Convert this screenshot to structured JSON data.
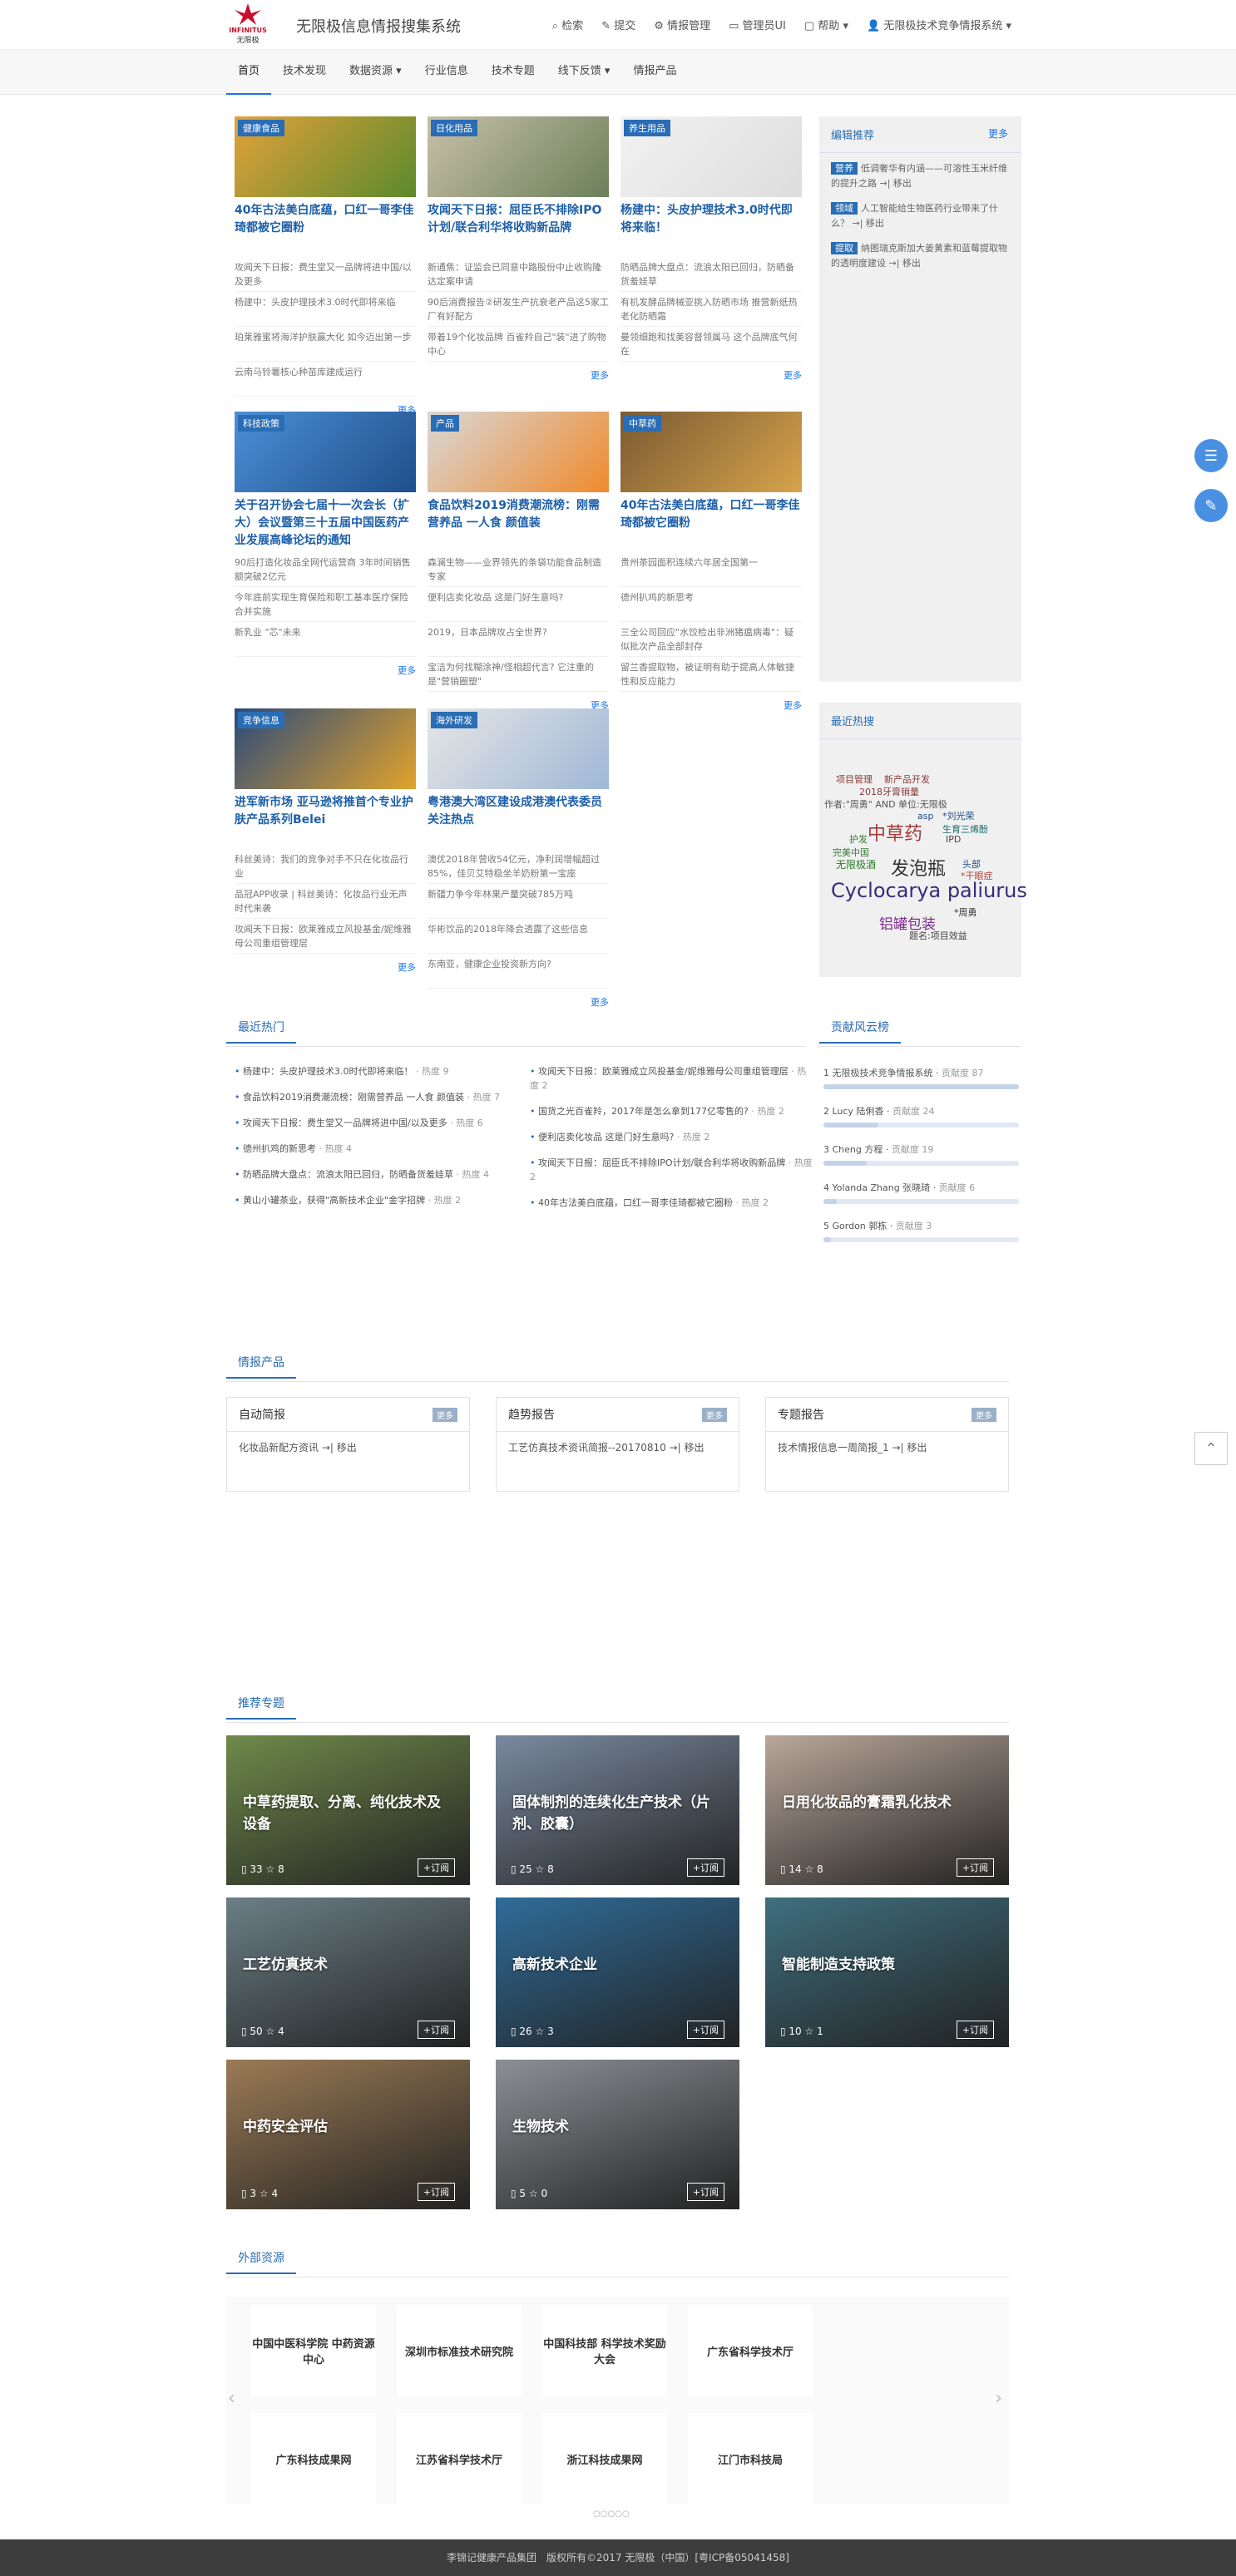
{
  "header": {
    "logo_en": "INFINITUS",
    "logo_cn": "无限极",
    "title": "无限极信息情报搜集系统",
    "nav": [
      "检索",
      "提交",
      "情报管理",
      "管理员UI",
      "帮助",
      "无限极技术竞争情报系统"
    ]
  },
  "menu": [
    "首页",
    "技术发现",
    "数据资源",
    "行业信息",
    "技术专题",
    "线下反馈",
    "情报产品"
  ],
  "cards": [
    {
      "tag": "健康食品",
      "title": "40年古法美白底蕴，口红一哥李佳琦都被它圈粉",
      "items": [
        "攻闻天下日报：费生堂又一品牌将进中国/以及更多",
        "杨建中：头皮护理技术3.0时代即将来临",
        "珀莱雅蜜将海洋护肤赢大化 如今迈出第一步",
        "云南马铃薯核心种苗库建成运行"
      ],
      "more": "更多"
    },
    {
      "tag": "日化用品",
      "title": "攻闻天下日报：屈臣氏不排除IPO计划/联合利华将收购新品牌",
      "items": [
        "新通焦：证监会已同意中路股份中止收购隆达定案申请",
        "90后消费报告②研发生产抗衰老产品这5家工厂有好配方",
        "带着19个化妆品牌 百雀羚自己\"装\"进了购物中心"
      ],
      "more": "更多"
    },
    {
      "tag": "养生用品",
      "title": "杨建中：头皮护理技术3.0时代即将来临！",
      "items": [
        "防晒品牌大盘点：流浪太阳已回归，防晒备货羞娃草",
        "有机发酵品牌械亚挑入防晒市场 推营新纸热老化防晒霜",
        "曼领细跑和找美容督领属马 这个品牌底气何在"
      ],
      "more": "更多"
    },
    {
      "tag": "科技政策",
      "title": "关于召开协会七届十一次会长（扩大）会议暨第三十五届中国医药产业发展高峰论坛的通知",
      "items": [
        "90后打造化妆品全网代运营商 3年时间销售额突破2亿元",
        "今年底前实现生育保险和职工基本医疗保险合并实施",
        "新乳业 \"芯\"未来"
      ],
      "more": "更多"
    },
    {
      "tag": "产品",
      "title": "食品饮料2019消费潮流榜：刚需营养品 一人食 颜值装",
      "items": [
        "森澜生物——业界领先的条袋功能食品制造专家",
        "便利店卖化妆品 这是门好生意吗?",
        "2019，日本品牌攻占全世界?",
        "宝洁为何找糊涂神/怪相超代言? 它注重的是\"营销圈塑\""
      ],
      "more": "更多"
    },
    {
      "tag": "中草药",
      "title": "40年古法美白底蕴，口红一哥李佳琦都被它圈粉",
      "items": [
        "贵州茶园面积连续六年居全国第一",
        "德州扒鸡的新思考",
        "三全公司回应\"水饺检出非洲猪瘟病毒\"：疑似批次产品全部封存",
        "留兰香提取物，被证明有助于提高人体敏捷性和反应能力"
      ],
      "more": "更多"
    },
    {
      "tag": "竞争信息",
      "title": "进军新市场 亚马逊将推首个专业护肤产品系列Belei",
      "items": [
        "科丝美诗：我们的竞争对手不只在化妆品行业",
        "品冠APP收录 | 科丝美诗：化妆品行业无声时代来袭",
        "攻闻天下日报：欧莱雅成立风投基金/妮维雅母公司重组管理层"
      ],
      "more": "更多"
    },
    {
      "tag": "海外研发",
      "title": "粤港澳大湾区建设成港澳代表委员关注热点",
      "items": [
        "澳优2018年营收54亿元，净利润增幅超过85%，佳贝艾特稳坐羊奶粉第一宝座",
        "新疆力争今年林果产量突破785万吨",
        "华彬饮品的2018年降会透露了这些信息",
        "东南亚，健康企业投资新方向?"
      ],
      "more": "更多"
    }
  ],
  "editor": {
    "title": "编辑推荐",
    "more": "更多",
    "items": [
      {
        "tag": "营养",
        "text": "低调奢华有内涵——可溶性玉米纤维的提升之路",
        "action": "→| 移出"
      },
      {
        "tag": "领域",
        "text": "人工智能给生物医药行业带来了什么？",
        "action": "→| 移出"
      },
      {
        "tag": "提取",
        "text": "纳图瑞克斯加大姜黄素和蓝莓提取物的透明度建设",
        "action": "→| 移出"
      }
    ]
  },
  "cloud": {
    "title": "最近热搜",
    "words": [
      "项目管理",
      "新产品开发",
      "2018牙膏销量",
      "作者:\"周勇\" AND 单位:无限极",
      "asp",
      "*刘光荣",
      "中草药",
      "生育三烯酚",
      "护发",
      "IPD",
      "完美中国",
      "无限极酒",
      "发泡瓶",
      "头部",
      "*干眼症",
      "Cyclocarya paliurus",
      "铝罐包装",
      "*周勇",
      "题名:项目效益"
    ]
  },
  "hot": {
    "title": "最近热门",
    "left": [
      {
        "t": "杨建中：头皮护理技术3.0时代即将来临！",
        "h": "热度 9"
      },
      {
        "t": "食品饮料2019消费潮流榜：刚需营养品 一人食 颜值装",
        "h": "热度 7"
      },
      {
        "t": "攻闻天下日报：费生堂又一品牌将进中国/以及更多",
        "h": "热度 6"
      },
      {
        "t": "德州扒鸡的新思考",
        "h": "热度 4"
      },
      {
        "t": "防晒品牌大盘点：流浪太阳已回归，防晒备货羞娃草",
        "h": "热度 4"
      },
      {
        "t": "黄山小罐茶业，获得\"高新技术企业\"金字招牌",
        "h": "热度 2"
      }
    ],
    "right": [
      {
        "t": "攻闻天下日报：欧莱雅成立风投基金/妮维雅母公司重组管理层",
        "h": "热度 2"
      },
      {
        "t": "国货之光百雀羚，2017年是怎么拿到177亿零售的?",
        "h": "热度 2"
      },
      {
        "t": "便利店卖化妆品 这是门好生意吗?",
        "h": "热度 2"
      },
      {
        "t": "攻闻天下日报：屈臣氏不排除IPO计划/联合利华将收购新品牌",
        "h": "热度 2"
      },
      {
        "t": "40年古法美白底蕴，口红一哥李佳琦都被它圈粉",
        "h": "热度 2"
      }
    ]
  },
  "rank": {
    "title": "贡献风云榜",
    "items": [
      {
        "n": "1",
        "name": "无限极技术竞争情报系统",
        "v": "贡献度 87",
        "pct": 1.0
      },
      {
        "n": "2",
        "name": "Lucy 陆俐香",
        "v": "贡献度 24",
        "pct": 0.28
      },
      {
        "n": "3",
        "name": "Cheng 方程",
        "v": "贡献度 19",
        "pct": 0.22
      },
      {
        "n": "4",
        "name": "Yolanda Zhang 张晓琦",
        "v": "贡献度 6",
        "pct": 0.07
      },
      {
        "n": "5",
        "name": "Gordon 郭栋",
        "v": "贡献度 3",
        "pct": 0.04
      }
    ]
  },
  "products": {
    "title": "情报产品",
    "boxes": [
      {
        "h": "自动简报",
        "badge": "更多",
        "item": "化妆品新配方资讯 →| 移出"
      },
      {
        "h": "趋势报告",
        "badge": "更多",
        "item": "工艺仿真技术资讯简报--20170810 →| 移出"
      },
      {
        "h": "专题报告",
        "badge": "更多",
        "item": "技术情报信息一周简报_1 →| 移出"
      }
    ]
  },
  "topics": {
    "title": "推荐专题",
    "items": [
      {
        "name": "中草药提取、分离、纯化技术及设备",
        "a": "33",
        "b": "8",
        "sub": "+订阅",
        "c": "#6f8a4a"
      },
      {
        "name": "固体制剂的连续化生产技术（片剂、胶囊）",
        "a": "25",
        "b": "8",
        "sub": "+订阅",
        "c": "#7a8aa0"
      },
      {
        "name": "日用化妆品的膏霜乳化技术",
        "a": "14",
        "b": "8",
        "sub": "+订阅",
        "c": "#b9a79a"
      },
      {
        "name": "工艺仿真技术",
        "a": "50",
        "b": "4",
        "sub": "+订阅",
        "c": "#6b7f86"
      },
      {
        "name": "高新技术企业",
        "a": "26",
        "b": "3",
        "sub": "+订阅",
        "c": "#2f6c99"
      },
      {
        "name": "智能制造支持政策",
        "a": "10",
        "b": "1",
        "sub": "+订阅",
        "c": "#3f6f7f"
      },
      {
        "name": "中药安全评估",
        "a": "3",
        "b": "4",
        "sub": "+订阅",
        "c": "#9b7b55"
      },
      {
        "name": "生物技术",
        "a": "5",
        "b": "0",
        "sub": "+订阅",
        "c": "#8c9096"
      }
    ]
  },
  "external": {
    "title": "外部资源",
    "items": [
      "中国中医科学院 中药资源中心",
      "深圳市标准技术研究院",
      "中国科技部 科学技术奖励大会",
      "广东省科学技术厅",
      "广东科技成果网",
      "江苏省科学技术厅",
      "浙江科技成果网",
      "江门市科技局"
    ]
  },
  "footer": "李锦记健康产品集团　版权所有©2017 无限极（中国）[粤ICP备05041458]"
}
